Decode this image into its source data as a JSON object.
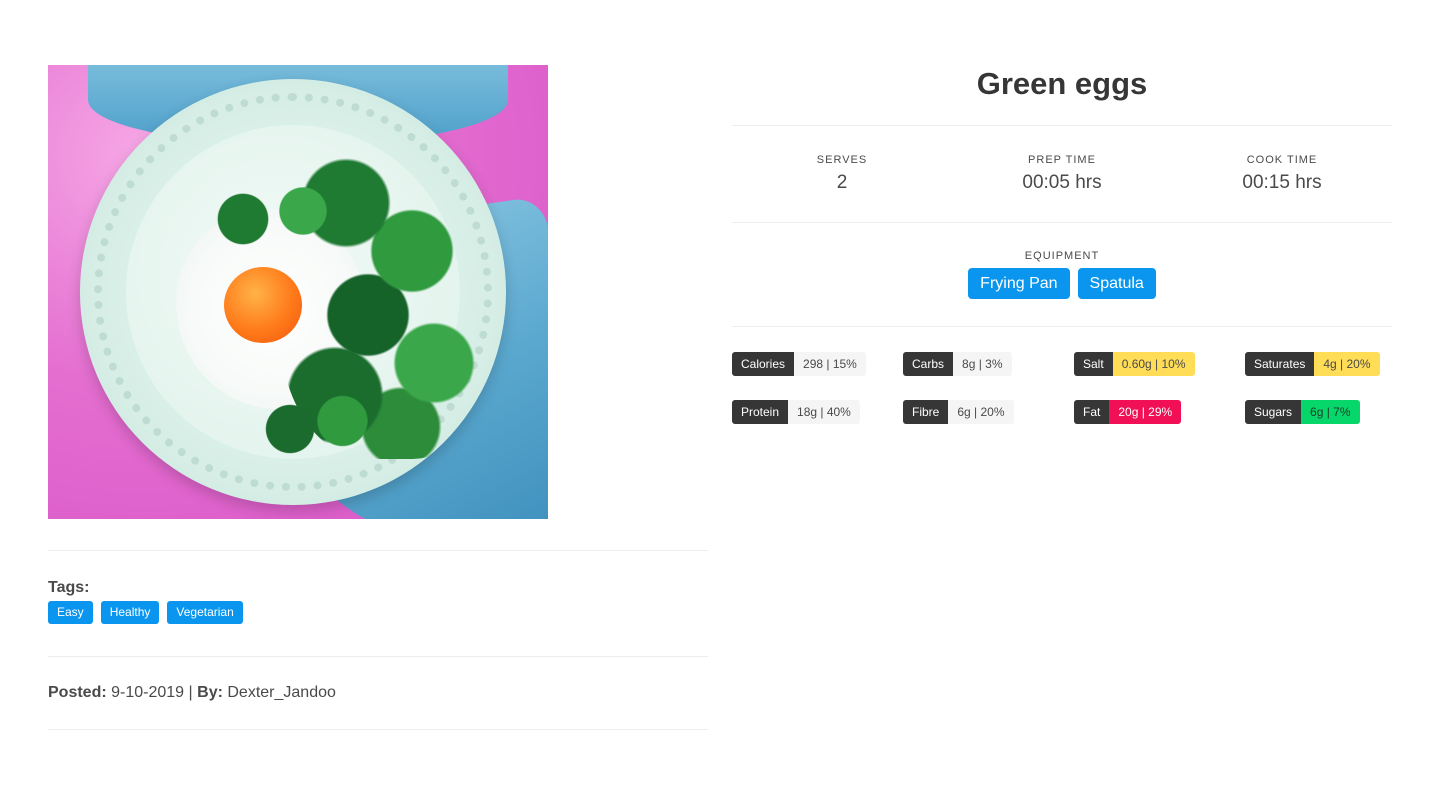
{
  "recipe": {
    "title": "Green eggs",
    "serves_label": "SERVES",
    "serves_value": "2",
    "prep_label": "PREP TIME",
    "prep_value": "00:05 hrs",
    "cook_label": "COOK TIME",
    "cook_value": "00:15 hrs",
    "equipment_label": "EQUIPMENT",
    "equipment": [
      "Frying Pan",
      "Spatula"
    ]
  },
  "nutrition": [
    {
      "label": "Calories",
      "value": "298 | 15%",
      "color": "#f5f5f5"
    },
    {
      "label": "Carbs",
      "value": "8g | 3%",
      "color": "#f5f5f5"
    },
    {
      "label": "Salt",
      "value": "0.60g | 10%",
      "color": "#ffdd57"
    },
    {
      "label": "Saturates",
      "value": "4g | 20%",
      "color": "#ffdd57"
    },
    {
      "label": "Protein",
      "value": "18g | 40%",
      "color": "#f5f5f5"
    },
    {
      "label": "Fibre",
      "value": "6g | 20%",
      "color": "#f5f5f5"
    },
    {
      "label": "Fat",
      "value": "20g | 29%",
      "color": "#f10f55"
    },
    {
      "label": "Sugars",
      "value": "6g | 7%",
      "color": "#07d66a"
    }
  ],
  "tags": {
    "label": "Tags:",
    "items": [
      "Easy",
      "Healthy",
      "Vegetarian"
    ]
  },
  "posted": {
    "posted_label": "Posted:",
    "date": "9-10-2019",
    "separator": "|",
    "by_label": "By:",
    "author": "Dexter_Jandoo"
  },
  "colors": {
    "accent": "#0a96ee",
    "dark": "#363636"
  }
}
